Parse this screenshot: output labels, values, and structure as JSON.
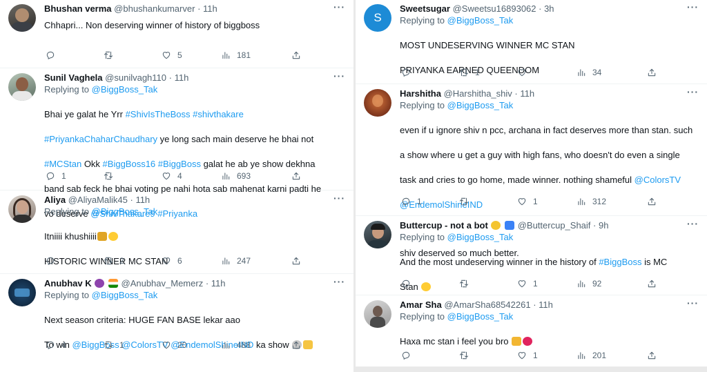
{
  "tweets_left": [
    {
      "name": "Bhushan verma",
      "handle": "@bhushankumarver",
      "time": "· 11h",
      "reply_prefix": "Replying to ",
      "reply_to": "",
      "lines": [
        "Chhapri... Non deserving winner of history of biggboss"
      ],
      "counts": {
        "reply": "",
        "retweet": "",
        "like": "5",
        "views": "181"
      }
    },
    {
      "name": "Sunil Vaghela",
      "handle": "@sunilvagh110",
      "time": "· 11h",
      "reply_prefix": "Replying to ",
      "reply_to": "@BiggBoss_Tak",
      "lines": [
        "Bhai ye galat he Yrr #ShivIsTheBoss #shivthakare",
        "#PriyankaChaharChaudhary ye long sach main deserve he bhai not",
        "#MCStan Okk #BiggBoss16 #BiggBoss galat he ab ye show dekhna",
        "band sab feck he bhai voting pe nahi hota sab mahenat karni padti he",
        "vo deserve @ShivThakare9 #Priyanka"
      ],
      "counts": {
        "reply": "1",
        "retweet": "",
        "like": "4",
        "views": "693"
      }
    },
    {
      "name": "Aliya",
      "handle": "@AliyaMalik45",
      "time": "· 11h",
      "reply_prefix": "Replying to ",
      "reply_to": "@BiggBoss_Tak",
      "lines": [
        "Itniiii khushiiii",
        "HISTORIC WINNER MC STAN"
      ],
      "counts": {
        "reply": "",
        "retweet": "2",
        "like": "6",
        "views": "247"
      }
    },
    {
      "name": "Anubhav K",
      "handle": "@Anubhav_Memerz",
      "time": "· 11h",
      "reply_prefix": "Replying to ",
      "reply_to": "@BiggBoss_Tak",
      "lines": [
        "Next season criteria: HUGE FAN BASE lekar aao",
        "To win @BiggBoss @ColorsTV @EndemolShineIND ka show"
      ],
      "counts": {
        "reply": "4",
        "retweet": "1",
        "like": "20",
        "views": "488"
      }
    }
  ],
  "tweets_right": [
    {
      "name": "Sweetsugar",
      "handle": "@Sweetsu16893062",
      "time": "· 3h",
      "avatar_letter": "S",
      "reply_prefix": "Replying to ",
      "reply_to": "@BiggBoss_Tak",
      "lines": [
        "MOST UNDESERVING  WINNER MC STAN",
        "PRIYANKA EARNED QUEENDOM"
      ],
      "counts": {
        "reply": "",
        "retweet": "1",
        "like": "",
        "views": "34"
      }
    },
    {
      "name": "Harshitha",
      "handle": "@Harshitha_shiv",
      "time": "· 11h",
      "reply_prefix": "Replying to ",
      "reply_to": "@BiggBoss_Tak",
      "lines": [
        "even if u ignore shiv n pcc, archana in fact deserves more than stan. such",
        "a show where u get a guy with high fans, who doesn't do even a single",
        "task and cries to go home, made winner. nothing shameful @ColorsTV",
        "@EndemolShineIND",
        "",
        "shiv deserved so much better."
      ],
      "counts": {
        "reply": "1",
        "retweet": "",
        "like": "1",
        "views": "312"
      }
    },
    {
      "name": "Buttercup - not a bot",
      "handle": "@Buttercup_Shaif",
      "time": "· 9h",
      "reply_prefix": "Replying to ",
      "reply_to": "@BiggBoss_Tak",
      "lines": [
        "And the most undeserving winner in the history of #BiggBoss is MC",
        "Stan"
      ],
      "counts": {
        "reply": "",
        "retweet": "",
        "like": "1",
        "views": "92"
      }
    },
    {
      "name": "Amar Sha",
      "handle": "@AmarSha68542261",
      "time": "· 11h",
      "reply_prefix": "Replying to ",
      "reply_to": "@BiggBoss_Tak",
      "lines": [
        "Haxa mc stan i feel you bro"
      ],
      "counts": {
        "reply": "",
        "retweet": "",
        "like": "1",
        "views": "201"
      }
    }
  ],
  "more_icon": "···",
  "colors": {
    "link": "#1d9bf0",
    "text": "#0f1419",
    "muted": "#536471",
    "accent": "#1d9bf0"
  }
}
